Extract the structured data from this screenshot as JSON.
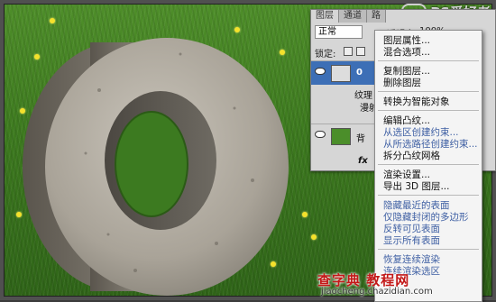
{
  "watermark_top": {
    "text": "PS爱好者"
  },
  "layers_panel": {
    "tabs": [
      "图层",
      "通道",
      "路"
    ],
    "blend_mode": "正常",
    "opacity_label": "不透明度:",
    "opacity_value": "100%",
    "lock_label": "锁定:",
    "layers": [
      {
        "name": "0"
      },
      {
        "name": "纹理"
      },
      {
        "name": "漫射"
      },
      {
        "name": "背"
      }
    ],
    "fx_label": "fx"
  },
  "context_menu": {
    "groups": [
      [
        "图层属性...",
        "混合选项..."
      ],
      [
        "复制图层...",
        "删除图层"
      ],
      [
        "转换为智能对象"
      ],
      [
        "编辑凸纹...",
        "从选区创建约束...",
        "从所选路径创建约束...",
        "拆分凸纹网格"
      ],
      [
        "渲染设置...",
        "导出 3D 图层..."
      ],
      [
        "隐藏最近的表面",
        "仅隐藏封闭的多边形",
        "反转可见表面",
        "显示所有表面"
      ],
      [
        "恢复连续渲染",
        "连续渲染选区"
      ]
    ],
    "disabled": [
      "从选区创建约束...",
      "从所选路径创建约束...",
      "隐藏最近的表面",
      "仅隐藏封闭的多边形",
      "反转可见表面",
      "显示所有表面",
      "恢复连续渲染",
      "连续渲染选区"
    ]
  },
  "watermark_bottom": {
    "main": "查字典 教程网",
    "url": "jiaocheng.chazidian.com"
  }
}
